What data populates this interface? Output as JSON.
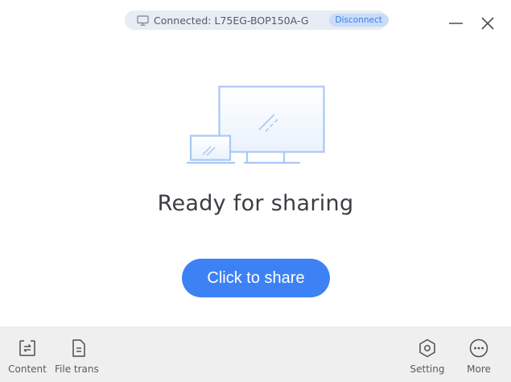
{
  "connection": {
    "status_text": "Connected: L75EG-BOP150A-G",
    "disconnect_label": "Disconnect"
  },
  "window_controls": {
    "minimize": "minimize-icon",
    "close": "close-icon"
  },
  "main": {
    "title": "Ready for sharing",
    "share_button_label": "Click to share",
    "illustration": "laptop-and-monitor-illustration"
  },
  "toolbar": {
    "content_label": "Content",
    "file_transfer_label": "File trans",
    "setting_label": "Setting",
    "more_label": "More"
  },
  "colors": {
    "accent": "#3d82f5",
    "illustration": "#a9c8f5",
    "toolbar_bg": "#efefef",
    "pill_bg": "#e8ecf4"
  }
}
